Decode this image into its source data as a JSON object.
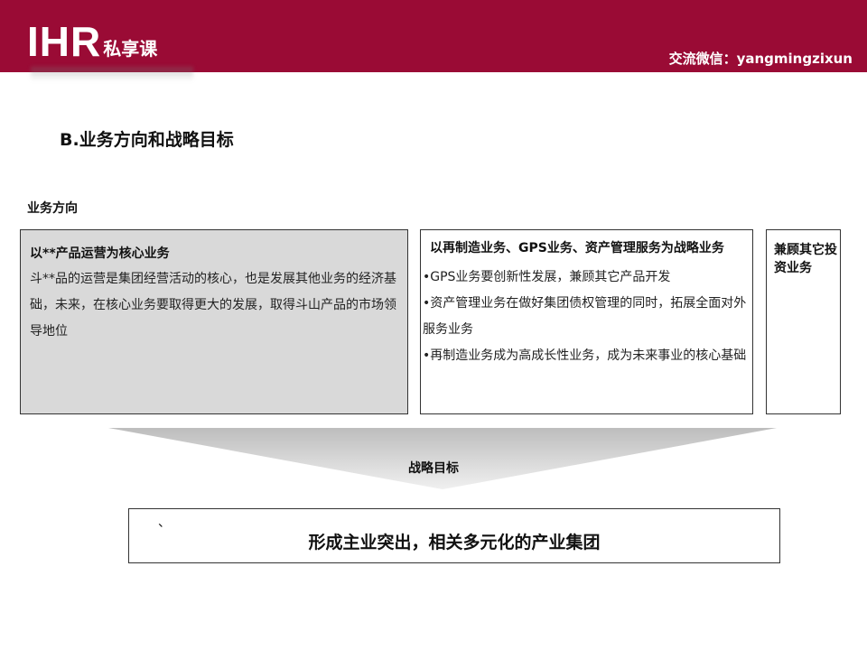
{
  "header": {
    "logo_mark": "IHR",
    "logo_sub": "私享课",
    "wechat": "交流微信：yangmingzixun",
    "color": "#9a0b35"
  },
  "section_title": "B.业务方向和战略目标",
  "direction_label": "业务方向",
  "boxes": [
    {
      "title": "以**产品运营为核心业务",
      "text": "斗**品的运营是集团经营活动的核心，也是发展其他业务的经济基础，未来，在核心业务要取得更大的发展，取得斗山产品的市场领导地位"
    },
    {
      "title": "以再制造业务、GPS业务、资产管理服务为战略业务",
      "bullets": [
        "•GPS业务要创新性发展，兼顾其它产品开发",
        "•资产管理业务在做好集团债权管理的同时，拓展全面对外服务业务",
        "•再制造业务成为高成长性业务，成为未来事业的核心基础"
      ]
    },
    {
      "title": "兼顾其它投资业务"
    }
  ],
  "goal_label": "战略目标",
  "goal_mark": "、",
  "goal_text": "形成主业突出，相关多元化的产业集团"
}
